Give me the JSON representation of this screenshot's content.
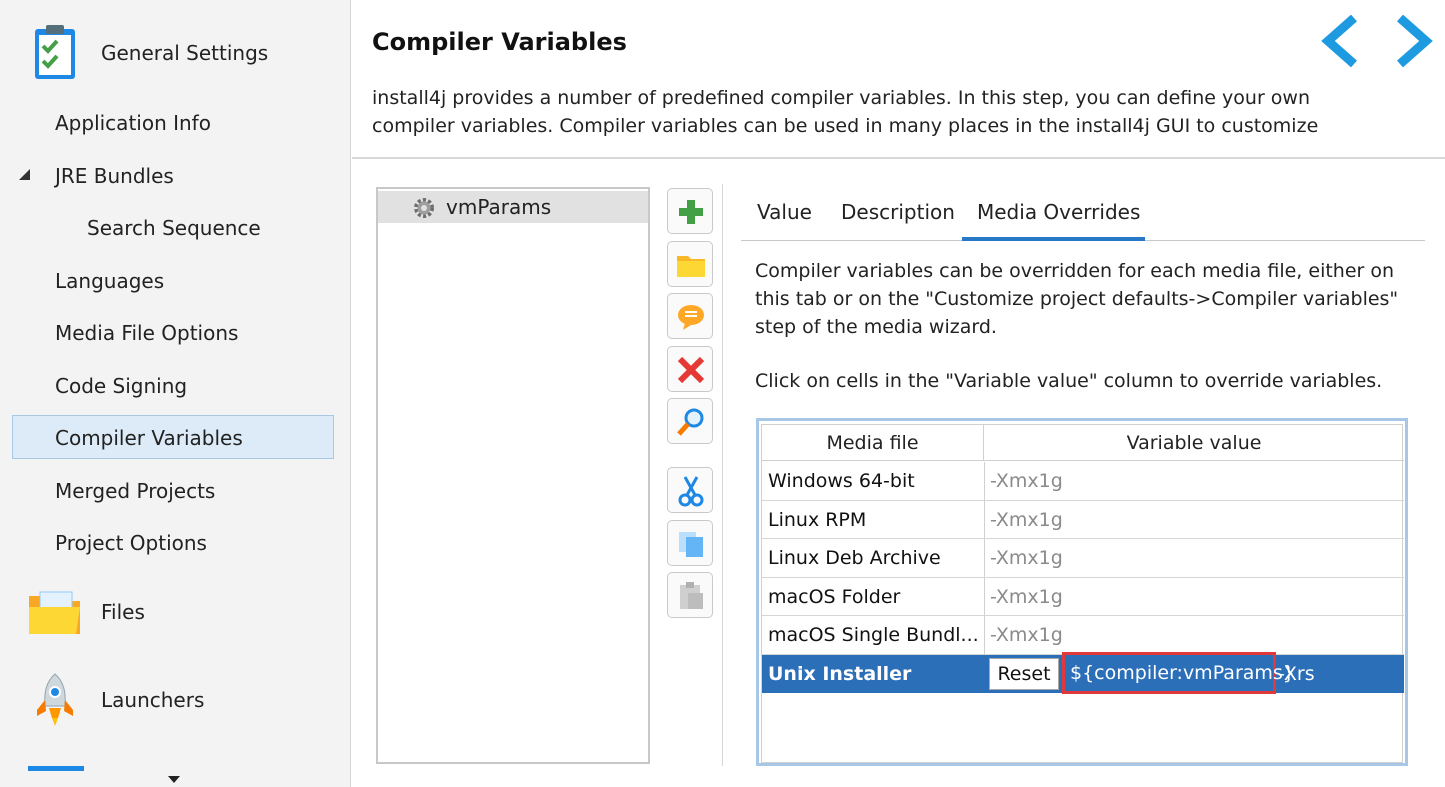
{
  "sidebar": {
    "general_settings": "General Settings",
    "items": [
      {
        "label": "Application Info"
      },
      {
        "label": "JRE Bundles"
      },
      {
        "label": "Search Sequence"
      },
      {
        "label": "Languages"
      },
      {
        "label": "Media File Options"
      },
      {
        "label": "Code Signing"
      },
      {
        "label": "Compiler Variables"
      },
      {
        "label": "Merged Projects"
      },
      {
        "label": "Project Options"
      }
    ],
    "files": "Files",
    "launchers": "Launchers",
    "selected_item": "Compiler Variables"
  },
  "header": {
    "title": "Compiler Variables",
    "description_line1": "install4j provides a number of predefined compiler variables. In this step, you can define your own",
    "description_line2": "compiler variables. Compiler variables can be used in many places in the install4j GUI to customize"
  },
  "variables": {
    "items": [
      {
        "name": "vmParams"
      }
    ]
  },
  "toolbar": {
    "buttons": [
      "add-icon",
      "folder-icon",
      "comment-icon",
      "delete-icon",
      "search-icon",
      "cut-icon",
      "copy-icon",
      "paste-icon"
    ]
  },
  "tabs": {
    "value": "Value",
    "description": "Description",
    "media_overrides": "Media Overrides",
    "active": "Media Overrides"
  },
  "media_overrides": {
    "help1": "Compiler variables can be overridden for each media file, either on this tab or on the \"Customize project defaults->Compiler variables\" step of the media wizard.",
    "help2": "Click on cells in the \"Variable value\" column to override variables.",
    "columns": {
      "media_file": "Media file",
      "variable_value": "Variable value"
    },
    "rows": [
      {
        "media_file": "Windows 64-bit",
        "value": "-Xmx1g"
      },
      {
        "media_file": "Linux RPM",
        "value": "-Xmx1g"
      },
      {
        "media_file": "Linux Deb Archive",
        "value": "-Xmx1g"
      },
      {
        "media_file": "macOS Folder",
        "value": "-Xmx1g"
      },
      {
        "media_file": "macOS Single Bundl...",
        "value": "-Xmx1g"
      }
    ],
    "selected_row": {
      "media_file": "Unix Installer",
      "reset_label": "Reset",
      "edit_value": "${compiler:vmParams}",
      "edit_suffix": "-Xrs"
    }
  },
  "colors": {
    "accent": "#2878c8",
    "selection": "#2b6fb8",
    "highlight_box": "#e0393b",
    "nav_arrow": "#1e9be0"
  }
}
